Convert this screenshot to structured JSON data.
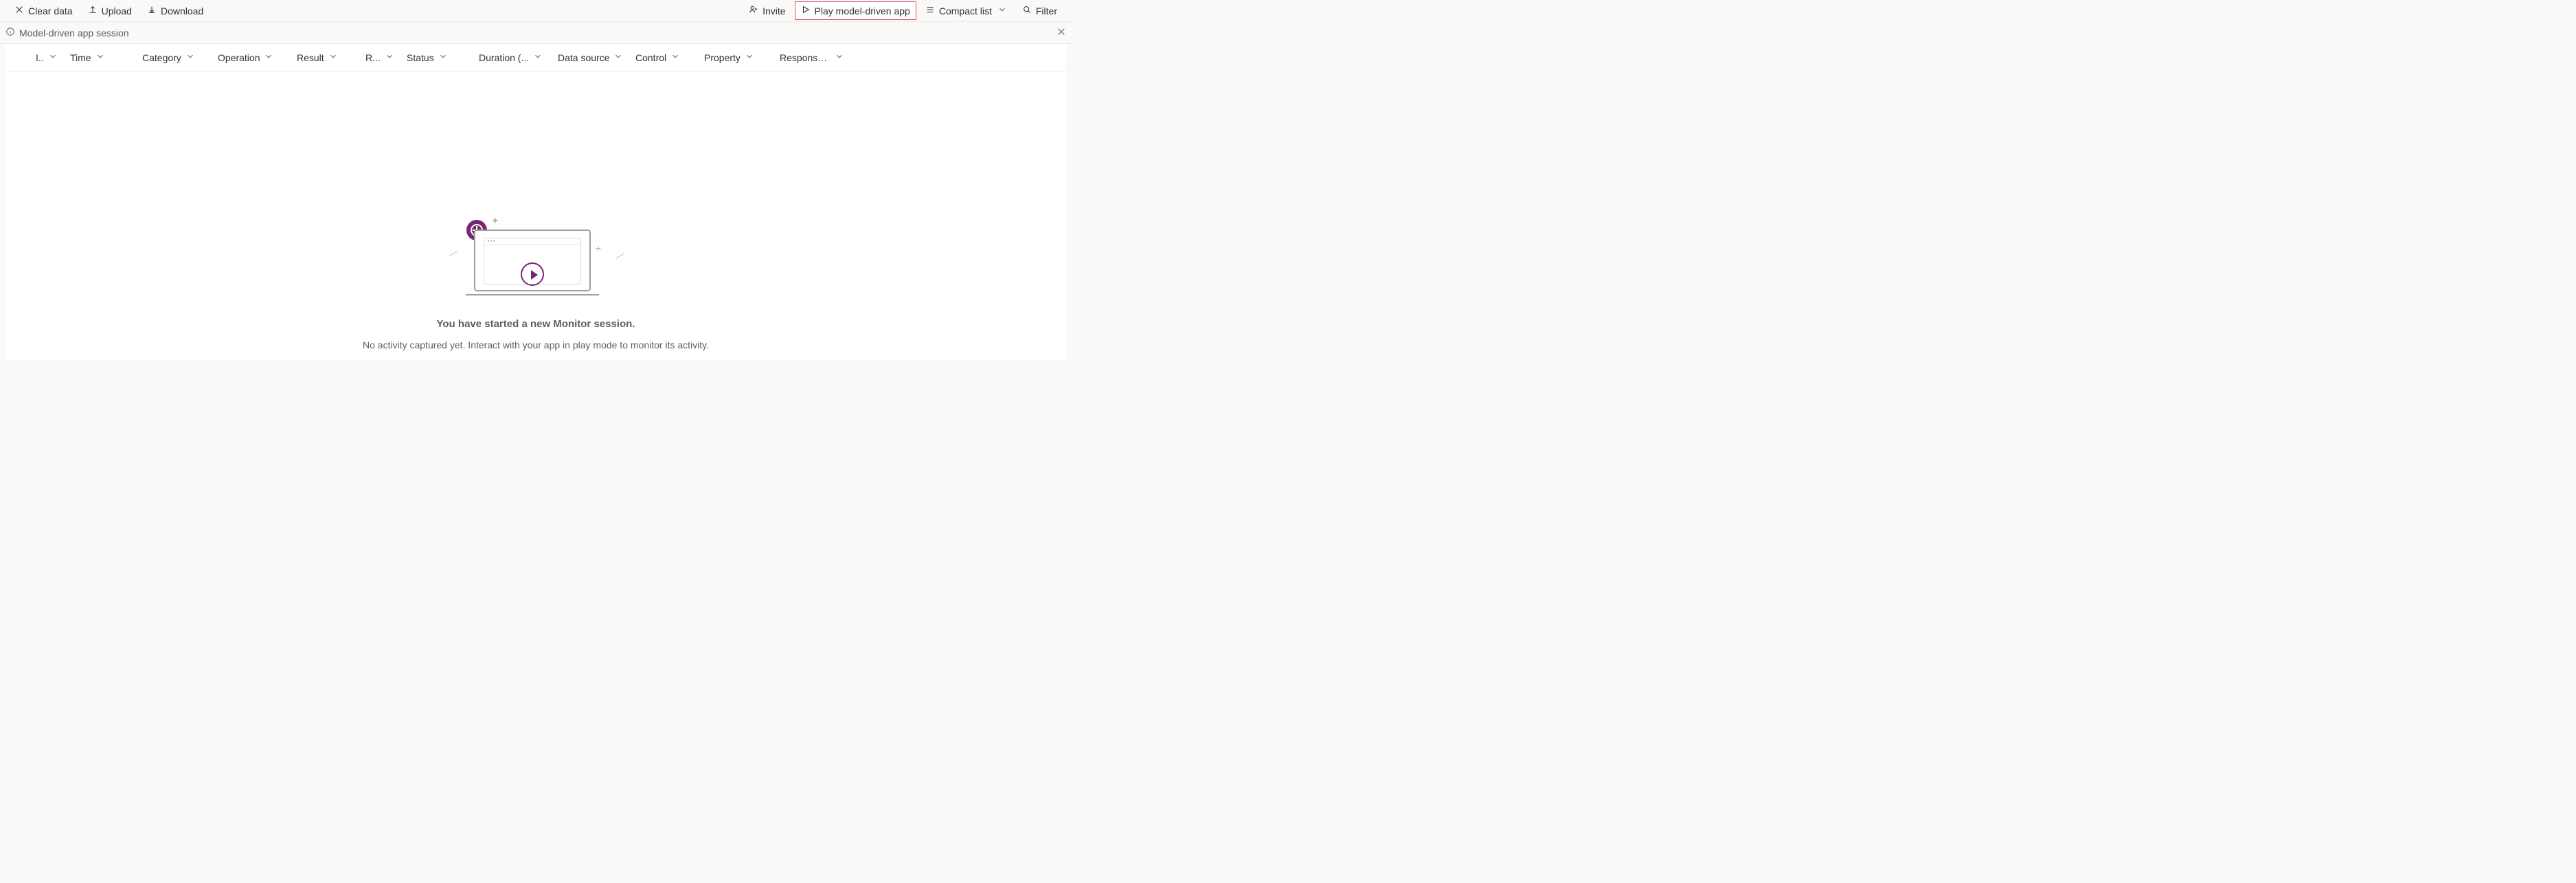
{
  "toolbar": {
    "clear_label": "Clear data",
    "upload_label": "Upload",
    "download_label": "Download",
    "invite_label": "Invite",
    "play_label": "Play model-driven app",
    "view_label": "Compact list",
    "filter_label": "Filter"
  },
  "session_bar": {
    "text": "Model-driven app session"
  },
  "columns": [
    "I..",
    "Time",
    "Category",
    "Operation",
    "Result",
    "R...",
    "Status",
    "Duration (...",
    "Data source",
    "Control",
    "Property",
    "Response ..."
  ],
  "empty_state": {
    "heading": "You have started a new Monitor session.",
    "subtext": "No activity captured yet. Interact with your app in play mode to monitor its activity."
  }
}
